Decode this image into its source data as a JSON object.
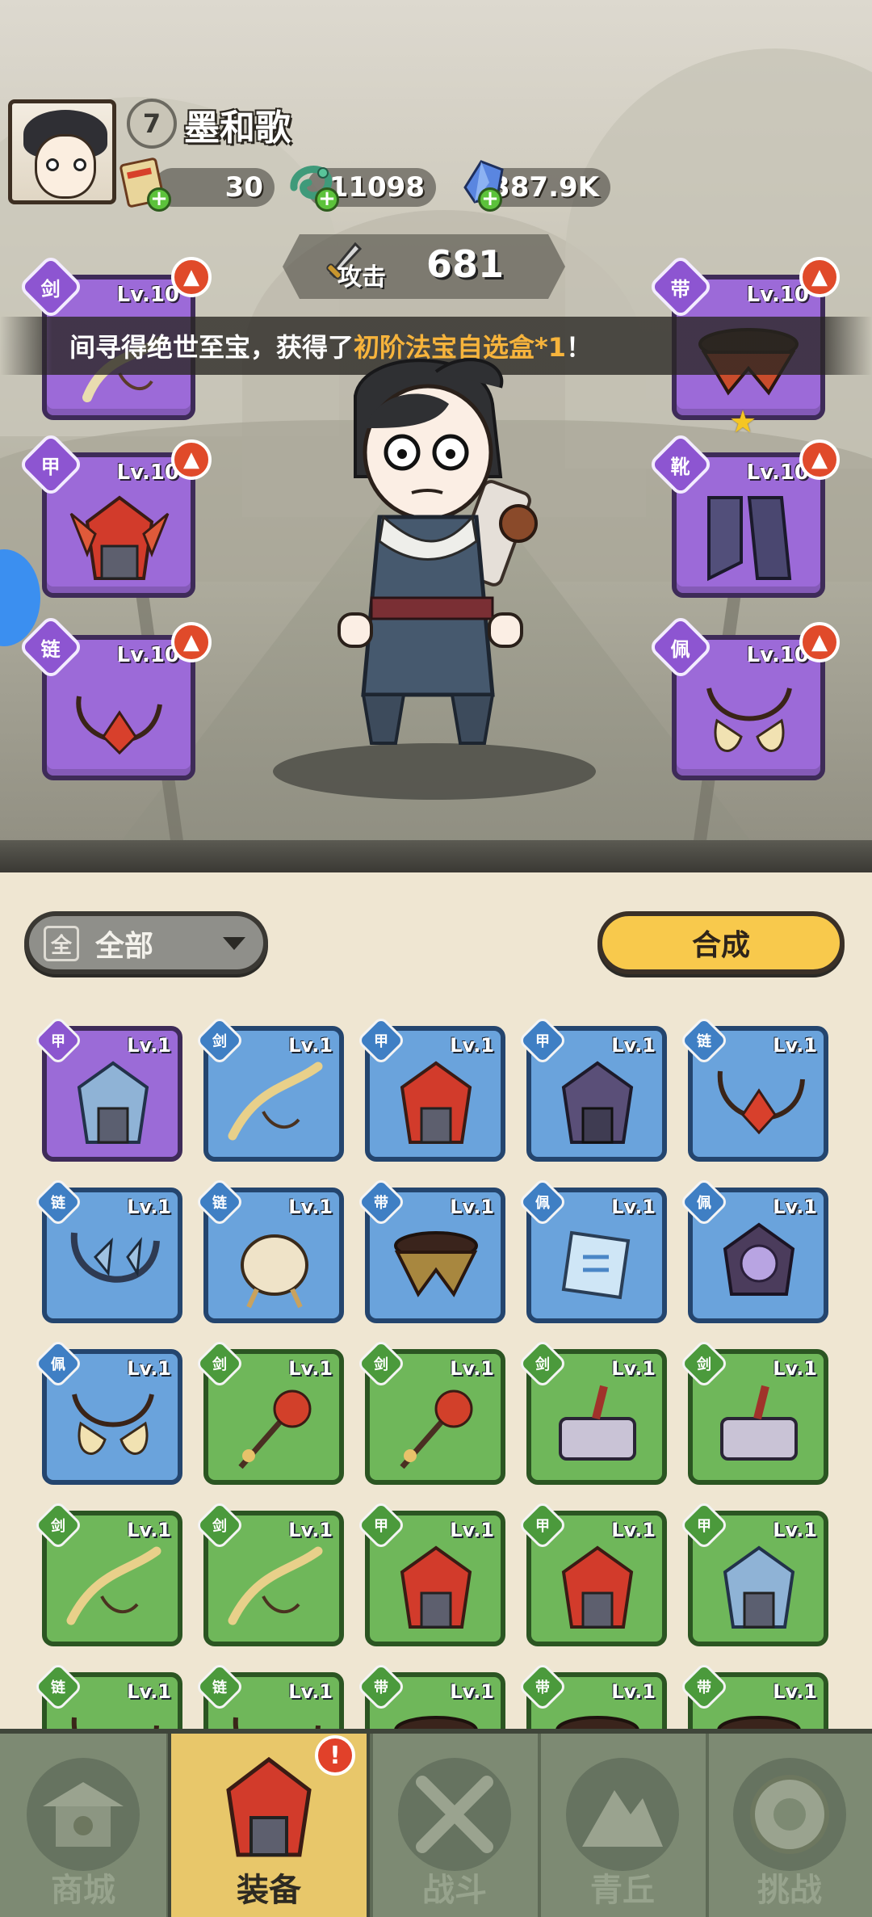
{
  "player": {
    "level": "7",
    "name": "墨和歌"
  },
  "resources": [
    {
      "icon": "ticket-scroll-icon",
      "value": "30"
    },
    {
      "icon": "jade-dragon-icon",
      "value": "11098"
    },
    {
      "icon": "crystal-icon",
      "value": "387.9K"
    }
  ],
  "attack": {
    "label": "攻击",
    "value": "681"
  },
  "banner": {
    "prefix": "间寻得绝世至宝，获得了 ",
    "highlight": "初阶法宝自选盒*1",
    "suffix": "！"
  },
  "equipped": {
    "left": [
      {
        "type": "weapon",
        "level": "Lv.10",
        "icon": "sword-whip-icon"
      },
      {
        "type": "helmet",
        "level": "Lv.10",
        "icon": "red-helmet-icon"
      },
      {
        "type": "necklace",
        "level": "Lv.10",
        "icon": "red-necklace-icon"
      }
    ],
    "right": [
      {
        "type": "belt",
        "level": "Lv.10",
        "icon": "belt-icon",
        "stars": 1
      },
      {
        "type": "boots",
        "level": "Lv.10",
        "icon": "boots-icon"
      },
      {
        "type": "amulet",
        "level": "Lv.10",
        "icon": "tooth-amulet-icon"
      }
    ]
  },
  "filter": {
    "prefix": "全",
    "label": "全部"
  },
  "combine_label": "合成",
  "inventory": [
    {
      "rarity": "purple",
      "level": "Lv.1",
      "icon": "ice-helmet-icon",
      "badge": "甲"
    },
    {
      "rarity": "blue",
      "level": "Lv.1",
      "icon": "golden-whip-icon",
      "badge": "剑"
    },
    {
      "rarity": "blue",
      "level": "Lv.1",
      "icon": "red-helmet-icon",
      "badge": "甲"
    },
    {
      "rarity": "blue",
      "level": "Lv.1",
      "icon": "dark-helmet-icon",
      "badge": "甲"
    },
    {
      "rarity": "blue",
      "level": "Lv.1",
      "icon": "red-necklace-icon",
      "badge": "链"
    },
    {
      "rarity": "blue",
      "level": "Lv.1",
      "icon": "ice-necklace-icon",
      "badge": "链"
    },
    {
      "rarity": "blue",
      "level": "Lv.1",
      "icon": "bone-necklace-icon",
      "badge": "链"
    },
    {
      "rarity": "blue",
      "level": "Lv.1",
      "icon": "belt-icon",
      "badge": "带"
    },
    {
      "rarity": "blue",
      "level": "Lv.1",
      "icon": "jade-talisman-icon",
      "badge": "佩"
    },
    {
      "rarity": "blue",
      "level": "Lv.1",
      "icon": "orb-amulet-icon",
      "badge": "佩"
    },
    {
      "rarity": "blue",
      "level": "Lv.1",
      "icon": "tooth-amulet-icon",
      "badge": "佩"
    },
    {
      "rarity": "green",
      "level": "Lv.1",
      "icon": "flower-staff-icon",
      "badge": "剑"
    },
    {
      "rarity": "green",
      "level": "Lv.1",
      "icon": "flower-staff-icon",
      "badge": "剑"
    },
    {
      "rarity": "green",
      "level": "Lv.1",
      "icon": "stone-hammer-icon",
      "badge": "剑"
    },
    {
      "rarity": "green",
      "level": "Lv.1",
      "icon": "stone-hammer-icon",
      "badge": "剑"
    },
    {
      "rarity": "green",
      "level": "Lv.1",
      "icon": "golden-whip-icon",
      "badge": "剑"
    },
    {
      "rarity": "green",
      "level": "Lv.1",
      "icon": "golden-whip-icon",
      "badge": "剑"
    },
    {
      "rarity": "green",
      "level": "Lv.1",
      "icon": "red-helmet-icon",
      "badge": "甲"
    },
    {
      "rarity": "green",
      "level": "Lv.1",
      "icon": "red-helmet-icon",
      "badge": "甲"
    },
    {
      "rarity": "green",
      "level": "Lv.1",
      "icon": "ice-helmet-icon",
      "badge": "甲"
    },
    {
      "rarity": "green",
      "level": "Lv.1",
      "icon": "necklace-icon",
      "badge": "链"
    },
    {
      "rarity": "green",
      "level": "Lv.1",
      "icon": "necklace-icon",
      "badge": "链"
    },
    {
      "rarity": "green",
      "level": "Lv.1",
      "icon": "belt-icon",
      "badge": "带"
    },
    {
      "rarity": "green",
      "level": "Lv.1",
      "icon": "belt-icon",
      "badge": "带"
    },
    {
      "rarity": "green",
      "level": "Lv.1",
      "icon": "belt-icon",
      "badge": "带"
    }
  ],
  "nav": [
    {
      "label": "商城",
      "icon": "shop-pagoda-icon",
      "active": false
    },
    {
      "label": "装备",
      "icon": "equipment-helmet-icon",
      "active": true,
      "alert": "!"
    },
    {
      "label": "战斗",
      "icon": "crossed-swords-icon",
      "active": false
    },
    {
      "label": "青丘",
      "icon": "mountain-icon",
      "active": false
    },
    {
      "label": "挑战",
      "icon": "orb-challenge-icon",
      "active": false
    }
  ],
  "colors": {
    "purple": "#9b6bd7",
    "blue": "#6aa3dc",
    "green": "#6fb75a",
    "highlight": "#f7b43c",
    "combine": "#f8c94c",
    "nav_active": "#e8c76a"
  }
}
